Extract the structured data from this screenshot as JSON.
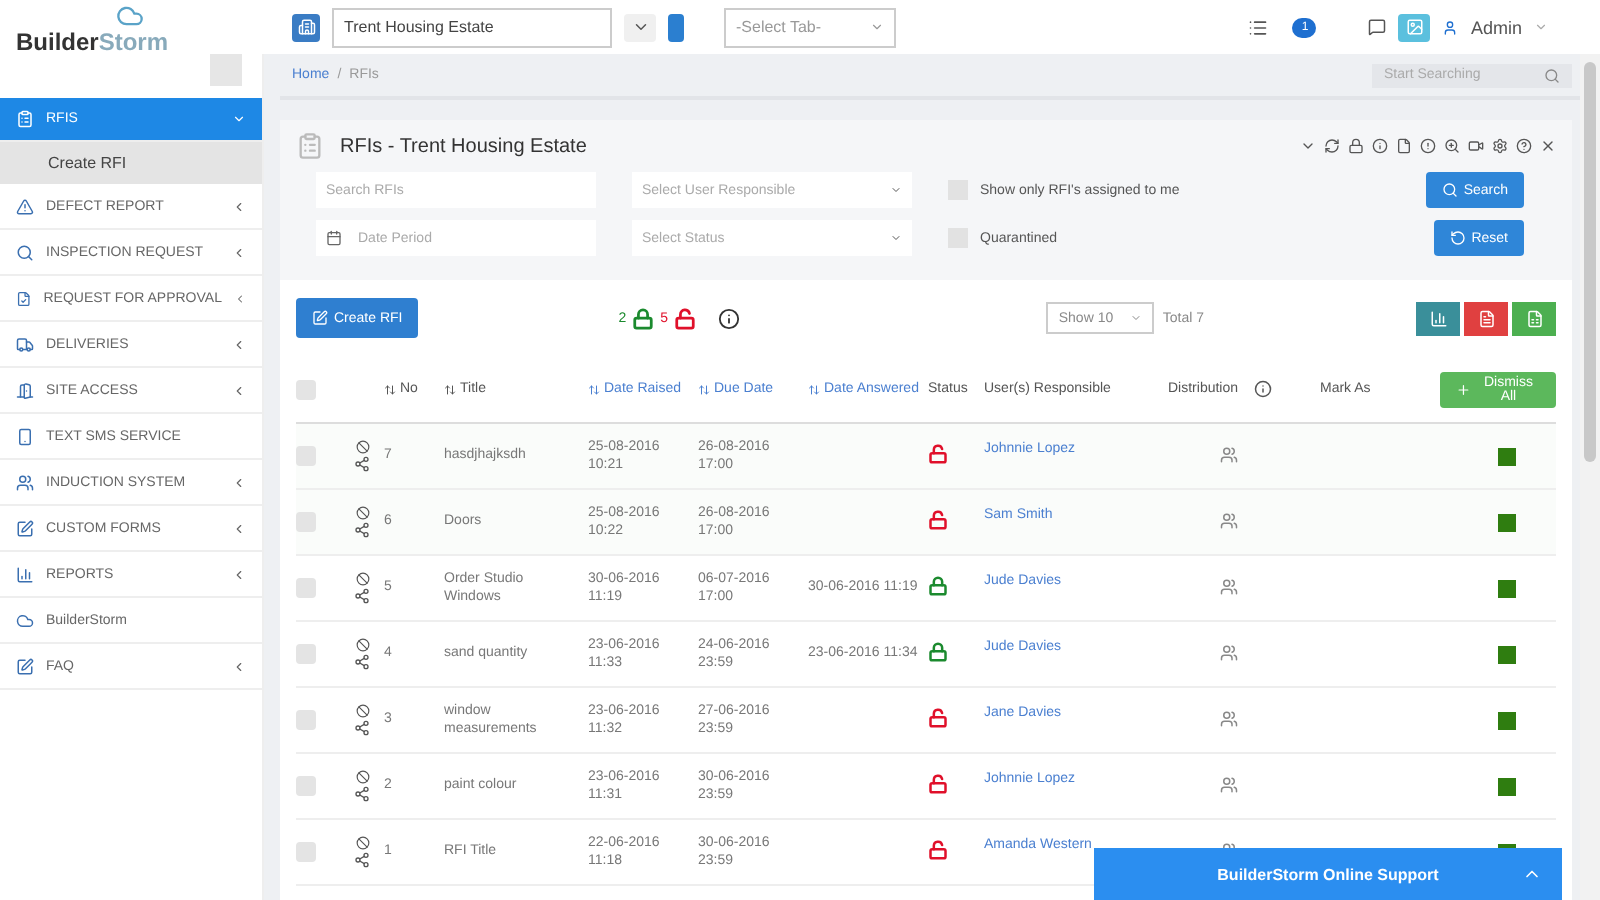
{
  "header": {
    "logo": {
      "part_1": "Builder",
      "part_2": "Storm"
    },
    "project_select": {
      "value": "Trent Housing Estate"
    },
    "tab_select": {
      "placeholder": "-Select Tab-"
    },
    "notification_count": "1",
    "user": "Admin"
  },
  "sidebar": {
    "items": [
      {
        "label": "RFIS",
        "kind": "group",
        "expanded": true,
        "selected": true,
        "children": [
          {
            "label": "Create RFI",
            "selected": true
          }
        ]
      },
      {
        "label": "DEFECT REPORT",
        "kind": "group",
        "expanded": false,
        "selected": false
      },
      {
        "label": "INSPECTION REQUEST",
        "kind": "group",
        "expanded": false,
        "selected": false
      },
      {
        "label": "REQUEST FOR APPROVAL",
        "kind": "group",
        "expanded": false,
        "selected": false
      },
      {
        "label": "DELIVERIES",
        "kind": "group",
        "expanded": false,
        "selected": false
      },
      {
        "label": "SITE ACCESS",
        "kind": "group",
        "expanded": false,
        "selected": false
      },
      {
        "label": "TEXT SMS SERVICE",
        "kind": "link",
        "selected": false
      },
      {
        "label": "INDUCTION SYSTEM",
        "kind": "group",
        "expanded": false,
        "selected": false
      },
      {
        "label": "CUSTOM FORMS",
        "kind": "group",
        "expanded": false,
        "selected": false
      },
      {
        "label": "REPORTS",
        "kind": "group",
        "expanded": false,
        "selected": false
      },
      {
        "label": "BuilderStorm",
        "kind": "link",
        "selected": false
      },
      {
        "label": "FAQ",
        "kind": "group",
        "expanded": false,
        "selected": false
      }
    ]
  },
  "breadcrumb": {
    "home": "Home",
    "separator": "/",
    "current": "RFIs"
  },
  "global_search": {
    "placeholder": "Start Searching"
  },
  "panel": {
    "title": "RFIs - Trent Housing Estate",
    "filters": {
      "search": {
        "placeholder": "Search RFIs"
      },
      "user_select": {
        "placeholder": "Select User Responsible"
      },
      "date": {
        "placeholder": "Date Period"
      },
      "status_select": {
        "placeholder": "Select Status"
      },
      "checkboxes": [
        {
          "label": "Show only RFI's assigned to me",
          "checked": false
        },
        {
          "label": "Quarantined",
          "checked": false
        }
      ],
      "search_button": "Search",
      "reset_button": "Reset"
    }
  },
  "create_button": "Create RFI",
  "counts": {
    "closed": "2",
    "open": "5"
  },
  "page_size": "Show 10",
  "total": "Total 7",
  "table": {
    "select_all_checked": false,
    "columns": [
      {
        "label": "No",
        "sortable": true
      },
      {
        "label": "Title",
        "sortable": true
      },
      {
        "label": "Date Raised",
        "sortable": true
      },
      {
        "label": "Due Date",
        "sortable": true
      },
      {
        "label": "Date Answered",
        "sortable": true
      },
      {
        "label": "Status",
        "sortable": false
      },
      {
        "label": "User(s) Responsible",
        "sortable": false
      },
      {
        "label": "Distribution",
        "sortable": false
      },
      {
        "label": "Mark As",
        "sortable": false
      }
    ],
    "dismiss_all": "Dismiss All",
    "rows": [
      {
        "checked": false,
        "no": "7",
        "title": "hasdjhajksdh",
        "raised": "25-08-2016 10:21",
        "due": "26-08-2016 17:00",
        "answered": "",
        "locked": false,
        "user": "Johnnie Lopez"
      },
      {
        "checked": false,
        "no": "6",
        "title": "Doors",
        "raised": "25-08-2016 10:22",
        "due": "26-08-2016 17:00",
        "answered": "",
        "locked": false,
        "user": "Sam Smith"
      },
      {
        "checked": false,
        "no": "5",
        "title": "Order Studio Windows",
        "raised": "30-06-2016 11:19",
        "due": "06-07-2016 17:00",
        "answered": "30-06-2016 11:19",
        "locked": true,
        "user": "Jude Davies"
      },
      {
        "checked": false,
        "no": "4",
        "title": "sand quantity",
        "raised": "23-06-2016 11:33",
        "due": "24-06-2016 23:59",
        "answered": "23-06-2016 11:34",
        "locked": true,
        "user": "Jude Davies"
      },
      {
        "checked": false,
        "no": "3",
        "title": "window measurements",
        "raised": "23-06-2016 11:32",
        "due": "27-06-2016 23:59",
        "answered": "",
        "locked": false,
        "user": "Jane Davies"
      },
      {
        "checked": false,
        "no": "2",
        "title": "paint colour",
        "raised": "23-06-2016 11:31",
        "due": "30-06-2016 23:59",
        "answered": "",
        "locked": false,
        "user": "Johnnie Lopez"
      },
      {
        "checked": false,
        "no": "1",
        "title": "RFI Title",
        "raised": "22-06-2016 11:18",
        "due": "30-06-2016 23:59",
        "answered": "",
        "locked": false,
        "user": "Amanda Western"
      }
    ]
  },
  "support_bar": "BuilderStorm Online Support"
}
